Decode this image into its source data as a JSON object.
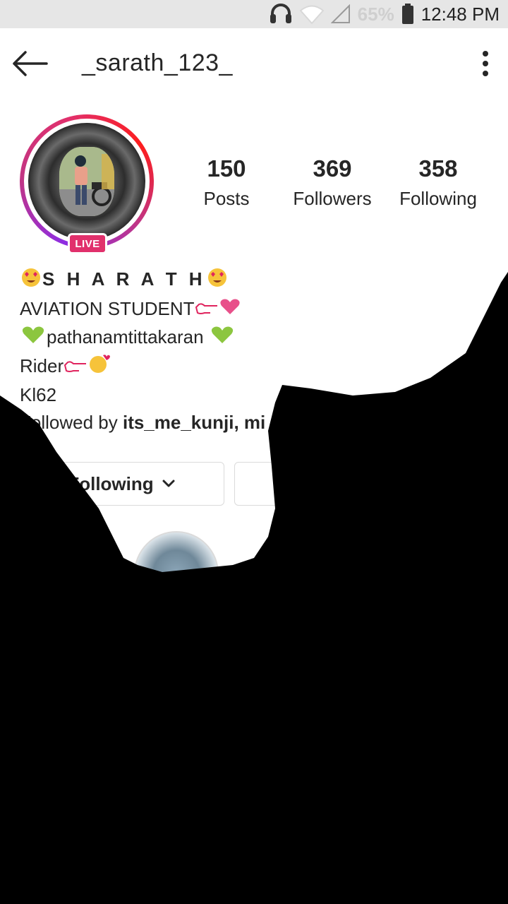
{
  "status_bar": {
    "battery_percent": "65%",
    "time": "12:48 PM",
    "icons": [
      "headset-icon",
      "wifi-icon",
      "signal-icon",
      "battery-icon"
    ]
  },
  "app_bar": {
    "username": "_sarath_123_",
    "back_icon": "arrow-left-icon",
    "menu_icon": "more-vertical-icon"
  },
  "profile": {
    "live_label": "LIVE",
    "stats": {
      "posts": {
        "value": "150",
        "label": "Posts"
      },
      "followers": {
        "value": "369",
        "label": "Followers"
      },
      "following": {
        "value": "358",
        "label": "Following"
      }
    },
    "bio": {
      "name": "S H A R A T H",
      "line1": "AVIATION STUDENT",
      "line2": "pathanamtittakaran",
      "line3": "Rider",
      "line4": "Kl62"
    },
    "followed_by": {
      "prefix": "Followed by ",
      "names": "its_me_kunji",
      "suffix": ", mi"
    }
  },
  "actions": {
    "following_label": "Following"
  },
  "colors": {
    "story_ring_start": "#8e2de2",
    "story_ring_end": "#e1306c",
    "live_badge": "#e1306c",
    "overlay": "#000000"
  }
}
